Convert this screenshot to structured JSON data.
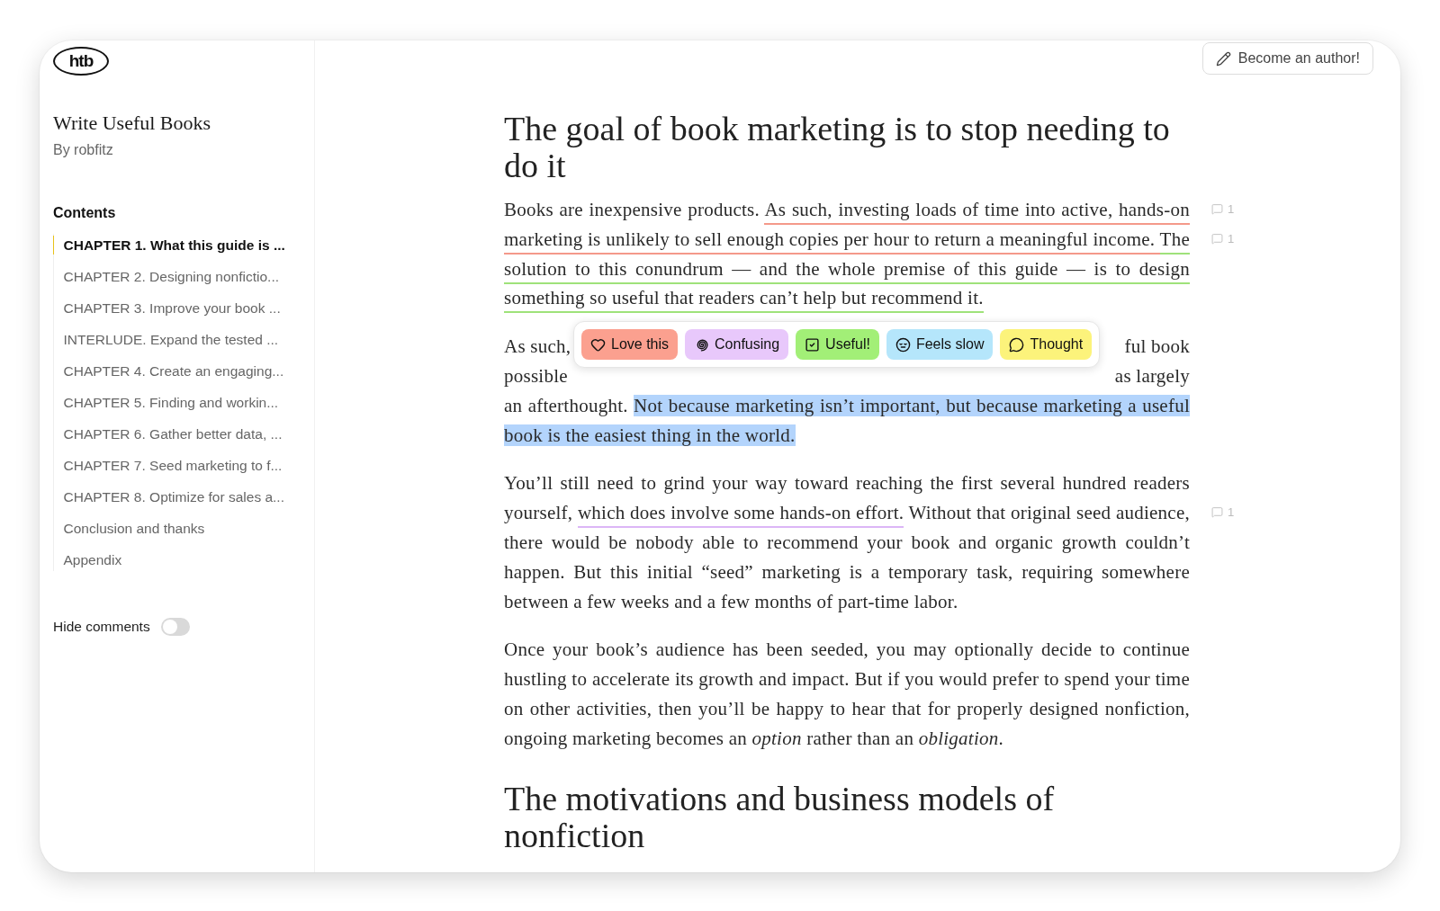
{
  "logo": "htb",
  "book": {
    "title": "Write Useful Books",
    "author": "By robfitz"
  },
  "contents": {
    "heading": "Contents",
    "items": [
      {
        "label": "CHAPTER 1. What this guide is ...",
        "selected": true
      },
      {
        "label": "CHAPTER 2. Designing nonfictio...",
        "selected": false
      },
      {
        "label": "CHAPTER 3. Improve your book ...",
        "selected": false
      },
      {
        "label": "INTERLUDE. Expand the tested ...",
        "selected": false
      },
      {
        "label": "CHAPTER 4. Create an engaging...",
        "selected": false
      },
      {
        "label": "CHAPTER 5. Finding and workin...",
        "selected": false
      },
      {
        "label": "CHAPTER 6. Gather better data, ...",
        "selected": false
      },
      {
        "label": "CHAPTER 7. Seed marketing to f...",
        "selected": false
      },
      {
        "label": "CHAPTER 8. Optimize for sales a...",
        "selected": false
      },
      {
        "label": "Conclusion and thanks",
        "selected": false
      },
      {
        "label": "Appendix",
        "selected": false
      }
    ]
  },
  "hide_comments": {
    "label": "Hide comments",
    "on": false
  },
  "author_button": "Become an author!",
  "article": [
    {
      "kind": "heading",
      "text": "The goal of book marketing is to stop needing to do it"
    },
    {
      "kind": "paragraph",
      "segments": [
        {
          "text": "Books are inexpensive products. ",
          "highlighted": false
        },
        {
          "text": "As such, investing loads of time into active, hands-on marketing is unlikely to sell enough copies per hour to return a meaningful income. ",
          "color": "#f4998a",
          "comments": "1",
          "highlighted": false
        },
        {
          "text": "The solution to this conundrum — and the whole premise of this guide — is to design something so useful that readers can’t help but recommend it.",
          "color": "#9fe27a",
          "comments": "1",
          "highlighted": false
        }
      ]
    },
    {
      "kind": "covered",
      "lines": [
        {
          "left": "As such,",
          "right": "ful book"
        },
        {
          "left": "possible",
          "right": "as largely"
        }
      ],
      "segments": [
        {
          "text": "an afterthought. ",
          "highlighted": false
        },
        {
          "text": "Not because marketing isn’t important, but because marketing a useful book is the easiest thing in the world.",
          "highlighted": true
        }
      ],
      "reactions": [
        {
          "label": "Love this",
          "kind": "heart",
          "color": "#fba08f"
        },
        {
          "label": "Confusing",
          "kind": "spiral",
          "color": "#e8c8fb"
        },
        {
          "label": "Useful!",
          "kind": "check",
          "color": "#a2ef77"
        },
        {
          "label": "Feels slow",
          "kind": "face",
          "color": "#b5e6fb"
        },
        {
          "label": "Thought",
          "kind": "bubble",
          "color": "#fcf37b"
        }
      ]
    },
    {
      "kind": "paragraph",
      "segments": [
        {
          "text": "You’ll still need to grind your way toward reaching the first several hundred readers yourself, ",
          "highlighted": false
        },
        {
          "text": "which does involve some hands-on effort.",
          "color": "#dcb6f6",
          "comments": "1",
          "highlighted": false
        },
        {
          "text": " Without that original seed audience, there would be nobody able to recommend your book and organic growth couldn’t happen. But this initial “seed” marketing is a temporary task, requiring somewhere between a few weeks and a few months of part-time labor.",
          "highlighted": false
        }
      ]
    },
    {
      "kind": "paragraph",
      "segments": [
        {
          "text": "Once your book’s audience has been seeded, you may optionally decide to continue hustling to accelerate its growth and impact. But if you would prefer to spend your time on other activities, then you’ll be happy to hear that for properly designed nonfiction, ongoing marketing becomes an *option* rather than an *obligation*.",
          "highlighted": false
        }
      ]
    },
    {
      "kind": "heading",
      "text": "The motivations and business models of nonfiction"
    }
  ]
}
